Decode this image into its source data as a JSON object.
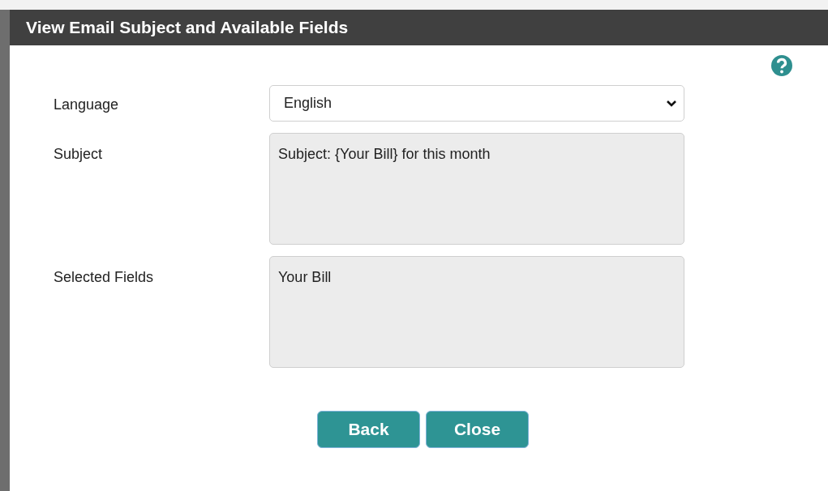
{
  "dialog": {
    "title": "View Email Subject and Available Fields"
  },
  "form": [
    {
      "kind": "select",
      "label": "Language",
      "value": "English"
    },
    {
      "kind": "textarea",
      "label": "Subject",
      "value": "Subject: {Your Bill} for this month"
    },
    {
      "kind": "textarea",
      "label": "Selected Fields",
      "value": "Your Bill"
    }
  ],
  "buttons": [
    "Back",
    "Close"
  ]
}
